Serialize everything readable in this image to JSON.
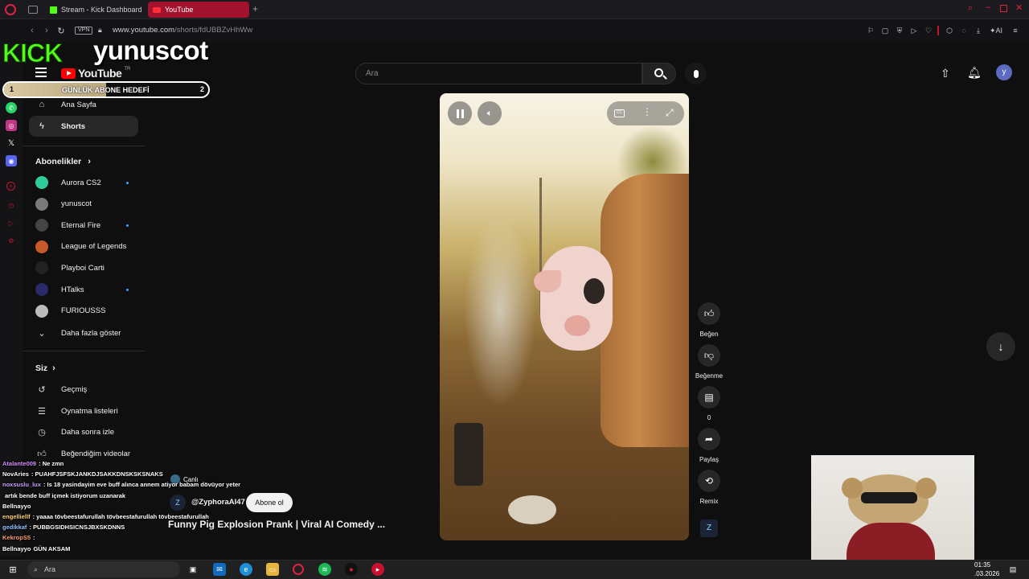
{
  "browser": {
    "tabs": [
      {
        "label": "Stream - Kick Dashboard",
        "active": false
      },
      {
        "label": "YouTube",
        "active": true
      }
    ],
    "url_host": "www.youtube.com",
    "url_path": "/shorts/fdUBBZvHhWw",
    "vpn_label": "VPN",
    "ai_label": "AI"
  },
  "overlay": {
    "kick_logo": "KICK",
    "streamer_name": "yunuscot",
    "goal_start": "1",
    "goal_label": "GÜNLÜK ABONE HEDEFİ",
    "goal_target": "2",
    "goal_progress": 0.5,
    "chat": [
      {
        "user": "Atalante009",
        "text": ": Ne zmn",
        "color": "#d98cff"
      },
      {
        "user": "NovAries",
        "text": ": PUAHFJSFSKJANKDJSAKKDNSKSKSNAKS",
        "color": "#ffffff"
      },
      {
        "user": "noxsuslu_lux",
        "text": ": Is 18 yasindayim eve buff alınca annem atiyor babam dövüyor yeter",
        "color": "#c9a0ff"
      },
      {
        "user": "",
        "text": "artık bende buff içmek istiyorum uzanarak",
        "color": "#ffffff"
      },
      {
        "user": "Bellnayyo",
        "text": "",
        "color": "#ffffff"
      },
      {
        "user": "engelliellf",
        "text": ": yaaaa tövbeestafurullah tövbeestafurullah tövbeestafurullah",
        "color": "#ffd27a"
      },
      {
        "user": "gedikkaf",
        "text": ": PUBBGSIDHSICNSJBXSKDNNS",
        "color": "#8fc2ff"
      },
      {
        "user": "KekropS5",
        "text": ":",
        "color": "#ff9d6b"
      },
      {
        "user": "Bellnayyo",
        "text": "GÜN AKSAM",
        "color": "#ffffff"
      }
    ]
  },
  "youtube": {
    "logo_text": "YouTube",
    "logo_region": "TR",
    "search_placeholder": "Ara",
    "avatar_letter": "y",
    "sidebar": {
      "home": "Ana Sayfa",
      "shorts": "Shorts",
      "subscriptions_header": "Abonelikler",
      "subscriptions": [
        {
          "name": "Aurora CS2",
          "new": true,
          "color": "#2ecc9a"
        },
        {
          "name": "yunuscot",
          "new": false,
          "color": "#7a7a7a"
        },
        {
          "name": "Eternal Fire",
          "new": true,
          "color": "#444"
        },
        {
          "name": "League of Legends",
          "new": false,
          "color": "#c7582a"
        },
        {
          "name": "Playboi Carti",
          "new": false,
          "color": "#222"
        },
        {
          "name": "HTalks",
          "new": true,
          "color": "#2a2a6a"
        },
        {
          "name": "FURIOUSSS",
          "new": false,
          "color": "#bbbbbb"
        }
      ],
      "show_more": "Daha fazla göster",
      "you_header": "Siz",
      "you_items": [
        "Geçmiş",
        "Oynatma listeleri",
        "Daha sonra izle",
        "Beğendiğim videolar"
      ]
    },
    "short": {
      "channel": "@ZyphoraAI47",
      "subscribe": "Abone ol",
      "title": "Funny Pig Explosion Prank | Viral AI Comedy ...",
      "live_badge": "Canlı"
    },
    "actions": {
      "like": "Beğen",
      "dislike": "Beğenme",
      "comments": "0",
      "share": "Paylaş",
      "remix": "Remix"
    }
  },
  "taskbar": {
    "search": "Ara",
    "time": "01:35",
    "date": ".03.2026"
  }
}
